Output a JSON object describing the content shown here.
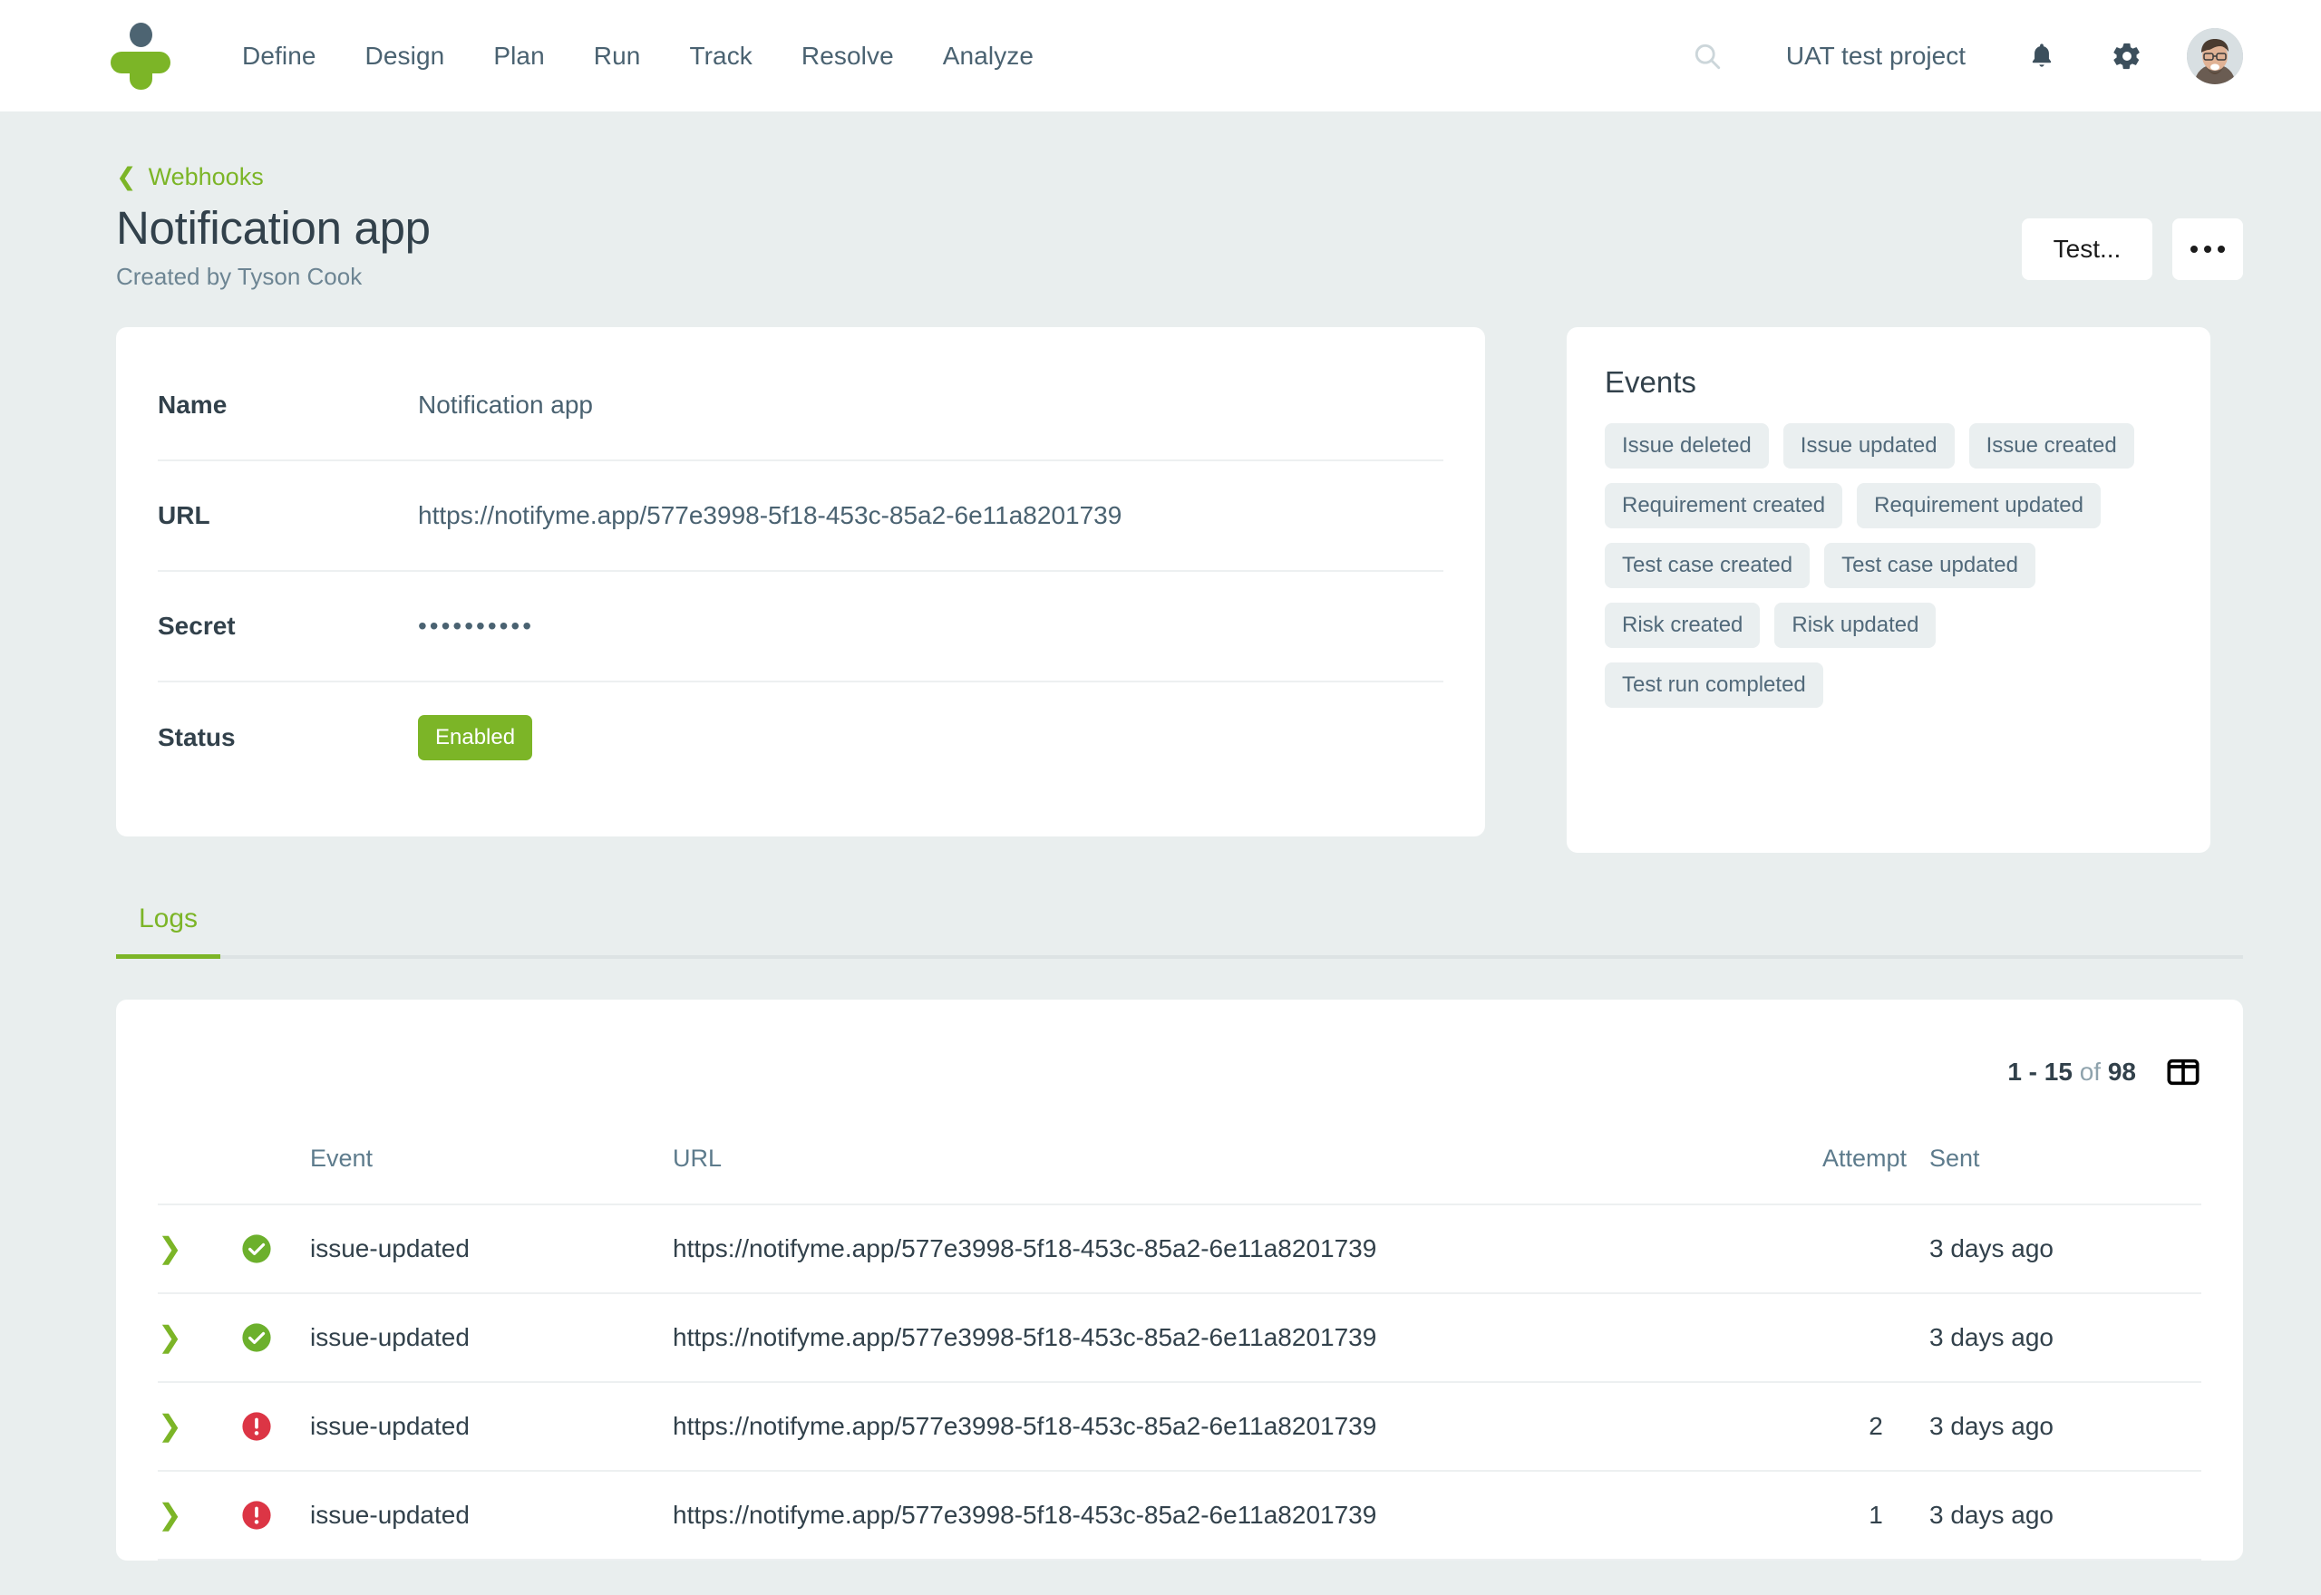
{
  "nav": {
    "logo_name": "testmonitor-logo",
    "links": [
      "Define",
      "Design",
      "Plan",
      "Run",
      "Track",
      "Resolve",
      "Analyze"
    ],
    "search_icon": "search-icon",
    "project": "UAT test project",
    "bell_icon": "bell-icon",
    "gear_icon": "gear-icon",
    "avatar": "user-avatar"
  },
  "breadcrumb": {
    "back_icon": "chevron-left-icon",
    "label": "Webhooks"
  },
  "header": {
    "title": "Notification app",
    "subtitle": "Created by Tyson Cook",
    "test_button": "Test...",
    "more_button": "more-options"
  },
  "details": {
    "rows": [
      {
        "label": "Name",
        "value": "Notification app",
        "type": "text"
      },
      {
        "label": "URL",
        "value": "https://notifyme.app/577e3998-5f18-453c-85a2-6e11a8201739",
        "type": "text"
      },
      {
        "label": "Secret",
        "value": "••••••••••",
        "type": "masked"
      },
      {
        "label": "Status",
        "value": "Enabled",
        "type": "badge"
      }
    ]
  },
  "events": {
    "title": "Events",
    "chips": [
      "Issue deleted",
      "Issue updated",
      "Issue created",
      "Requirement created",
      "Requirement updated",
      "Test case created",
      "Test case updated",
      "Risk created",
      "Risk updated",
      "Test run completed"
    ]
  },
  "tabs": [
    {
      "label": "Logs",
      "active": true
    }
  ],
  "logs": {
    "pagination": {
      "range": "1 - 15",
      "of": "of",
      "total": "98"
    },
    "columns_icon": "columns-layout-icon",
    "headers": [
      "",
      "",
      "Event",
      "URL",
      "Attempt",
      "Sent"
    ],
    "rows": [
      {
        "status": "success",
        "event": "issue-updated",
        "url": "https://notifyme.app/577e3998-5f18-453c-85a2-6e11a8201739",
        "attempt": "",
        "sent": "3 days ago"
      },
      {
        "status": "success",
        "event": "issue-updated",
        "url": "https://notifyme.app/577e3998-5f18-453c-85a2-6e11a8201739",
        "attempt": "",
        "sent": "3 days ago"
      },
      {
        "status": "error",
        "event": "issue-updated",
        "url": "https://notifyme.app/577e3998-5f18-453c-85a2-6e11a8201739",
        "attempt": "2",
        "sent": "3 days ago"
      },
      {
        "status": "error",
        "event": "issue-updated",
        "url": "https://notifyme.app/577e3998-5f18-453c-85a2-6e11a8201739",
        "attempt": "1",
        "sent": "3 days ago"
      }
    ]
  },
  "colors": {
    "brand_green": "#7cb527",
    "page_bg": "#e9eeee",
    "text_dark": "#32414b",
    "text_muted": "#5d7b8c",
    "success": "#6cb02c",
    "error": "#dc3545"
  }
}
